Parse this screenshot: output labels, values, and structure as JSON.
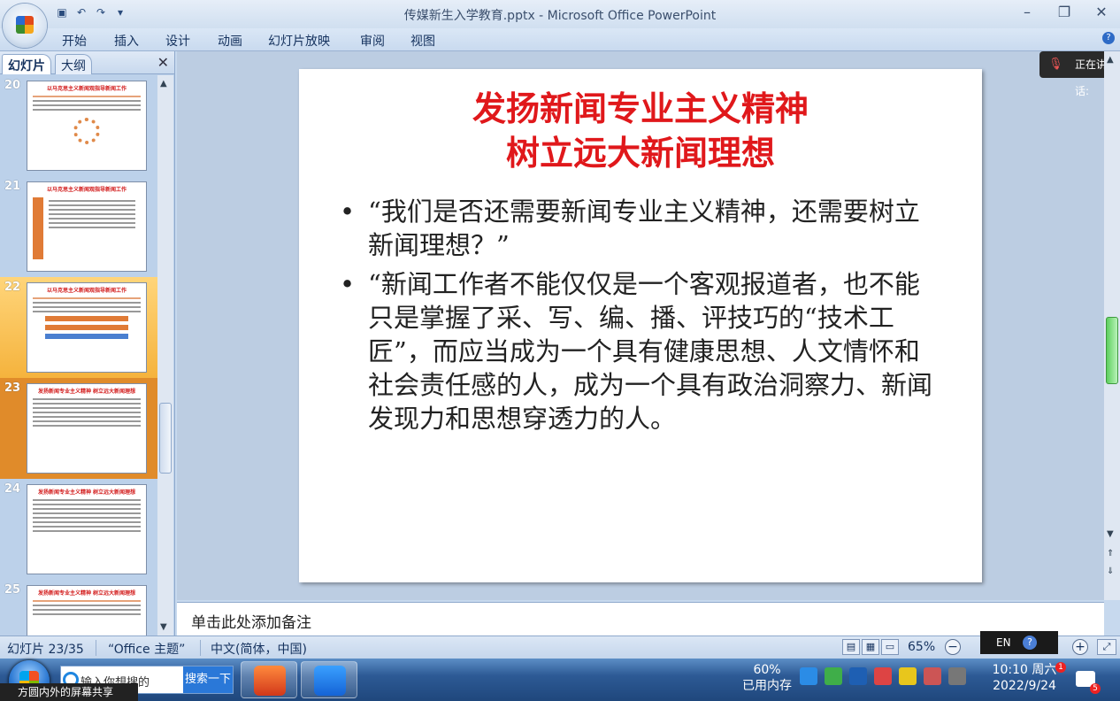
{
  "window": {
    "title": "传媒新生入学教育.pptx - Microsoft Office PowerPoint",
    "minimize": "–",
    "restore": "❐",
    "close": "✕"
  },
  "menu": [
    "开始",
    "插入",
    "设计",
    "动画",
    "幻灯片放映",
    "审阅",
    "视图"
  ],
  "left_pane": {
    "tabs": [
      "幻灯片",
      "大纲"
    ],
    "close": "✕",
    "thumbnails": [
      {
        "num": "20",
        "title": "以马克思主义新闻观指导新闻工作"
      },
      {
        "num": "21",
        "title": "以马克思主义新闻观指导新闻工作"
      },
      {
        "num": "22",
        "title": "以马克思主义新闻观指导新闻工作"
      },
      {
        "num": "23",
        "title": "发扬新闻专业主义精神 树立远大新闻理想"
      },
      {
        "num": "24",
        "title": "发扬新闻专业主义精神 树立远大新闻理想"
      },
      {
        "num": "25",
        "title": "发扬新闻专业主义精神 树立远大新闻理想"
      }
    ]
  },
  "slide": {
    "title_line1": "发扬新闻专业主义精神",
    "title_line2": "树立远大新闻理想",
    "bullets": [
      "“我们是否还需要新闻专业主义精神，还需要树立新闻理想？”",
      "“新闻工作者不能仅仅是一个客观报道者，也不能只是掌握了采、写、编、播、评技巧的“技术工匠”，而应当成为一个具有健康思想、人文情怀和社会责任感的人，成为一个具有政治洞察力、新闻发现力和思想穿透力的人。"
    ]
  },
  "speaking": {
    "label": "正在讲话:"
  },
  "notes": {
    "placeholder": "单击此处添加备注"
  },
  "status": {
    "slide_info": "幻灯片 23/35",
    "theme": "“Office 主题”",
    "language": "中文(简体，中国)",
    "zoom": "65%"
  },
  "ime": {
    "lang": "EN",
    "help": "?"
  },
  "taskbar": {
    "search_placeholder": "输入你想搜的",
    "search_button": "搜索一下",
    "memory_pct": "60%",
    "memory_label": "已用内存",
    "time": "10:10 周六",
    "date": "2022/9/24",
    "clock_badge": "1",
    "notif_badge": "5",
    "share_label": "方圆内外的屏幕共享"
  }
}
